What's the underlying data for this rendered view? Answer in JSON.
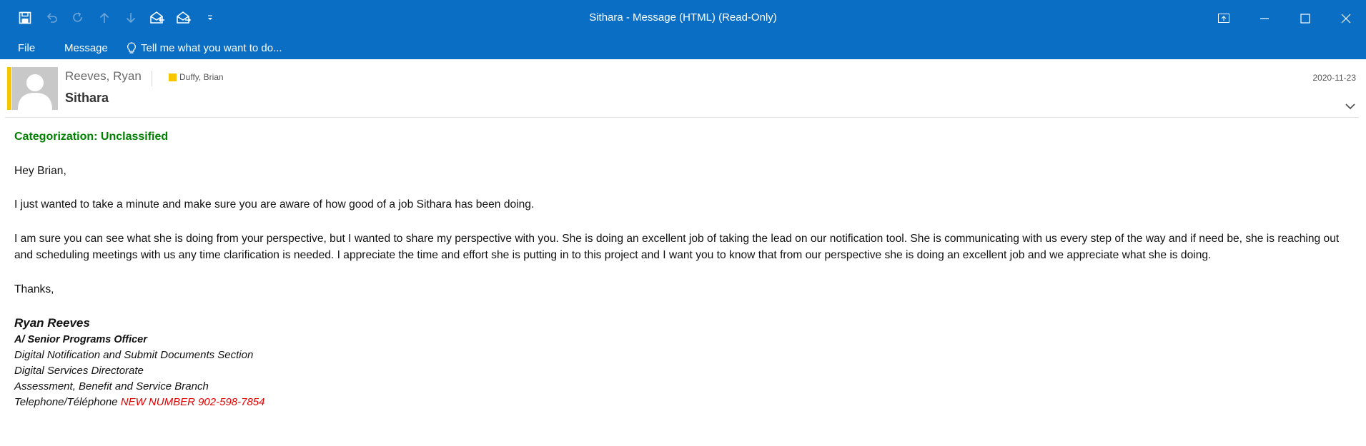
{
  "window": {
    "title": "Sithara - Message (HTML) (Read-Only)"
  },
  "ribbon": {
    "file_label": "File",
    "message_label": "Message",
    "tell_me_placeholder": "Tell me what you want to do..."
  },
  "header": {
    "from": "Reeves, Ryan",
    "to": "Duffy, Brian",
    "subject": "Sithara",
    "date": "2020-11-23",
    "category_color": "#f7c600"
  },
  "body": {
    "categorization": "Categorization: Unclassified",
    "greeting": "Hey Brian,",
    "paragraph1": "I just wanted to take a minute and make sure you are aware of how good of a job Sithara has been doing.",
    "paragraph2": "I am sure you can see what she is doing from your perspective, but I wanted to share my perspective with you. She is doing an excellent job of taking the lead on our notification tool. She is communicating with us every step of the way and if need be, she is reaching out and scheduling meetings with us any time clarification is needed. I appreciate the time and effort she is putting in to this project and I want you to know that from our perspective she is doing an excellent job and we appreciate what she is doing.",
    "closing": "Thanks,"
  },
  "signature": {
    "name": "Ryan Reeves",
    "title": "A/ Senior Programs Officer",
    "section": "Digital Notification and Submit Documents Section",
    "directorate": "Digital Services Directorate",
    "branch": "Assessment, Benefit and Service Branch",
    "phone_label": "Telephone/Téléphone",
    "phone_value": "NEW NUMBER 902-598-7854"
  },
  "colors": {
    "titlebar": "#0a6fc4",
    "categorization": "#008000",
    "phone": "#e00000"
  }
}
